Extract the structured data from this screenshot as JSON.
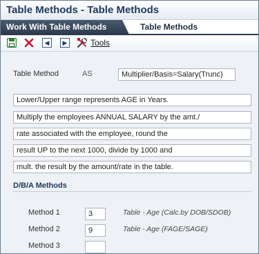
{
  "window": {
    "title": "Table Methods - Table Methods"
  },
  "tabs": [
    {
      "label": "Work With Table Methods"
    },
    {
      "label": "Table Methods"
    }
  ],
  "toolbar": {
    "save_icon": "save-icon",
    "close_icon": "close-icon",
    "prev_icon": "previous-icon",
    "next_icon": "next-icon",
    "tools_icon": "tools-icon",
    "tools_label": "Tools"
  },
  "form": {
    "table_method_label": "Table Method",
    "table_method_code": "AS",
    "table_method_description": "Multiplier/Basis=Salary(Trunc)",
    "description_lines": [
      "Lower/Upper range represents AGE in Years.",
      "Multiply the employees ANNUAL SALARY by the amt./",
      "rate associated with the employee, round the",
      "result UP to the next 1000, divide by 1000 and",
      "mult. the result by the amount/rate in the table."
    ]
  },
  "dba_methods": {
    "title": "D/B/A Methods",
    "methods": [
      {
        "label": "Method 1",
        "value": "3",
        "description": "Table - Age (Calc.by DOB/SDOB)"
      },
      {
        "label": "Method 2",
        "value": "9",
        "description": "Table - Age (FAGE/SAGE)"
      },
      {
        "label": "Method 3",
        "value": "",
        "description": ""
      }
    ]
  },
  "colors": {
    "title": "#1f3a60",
    "tab_active_bg": "#2c3a4c",
    "close_red": "#c8102e",
    "save_green": "#2e7d32"
  }
}
